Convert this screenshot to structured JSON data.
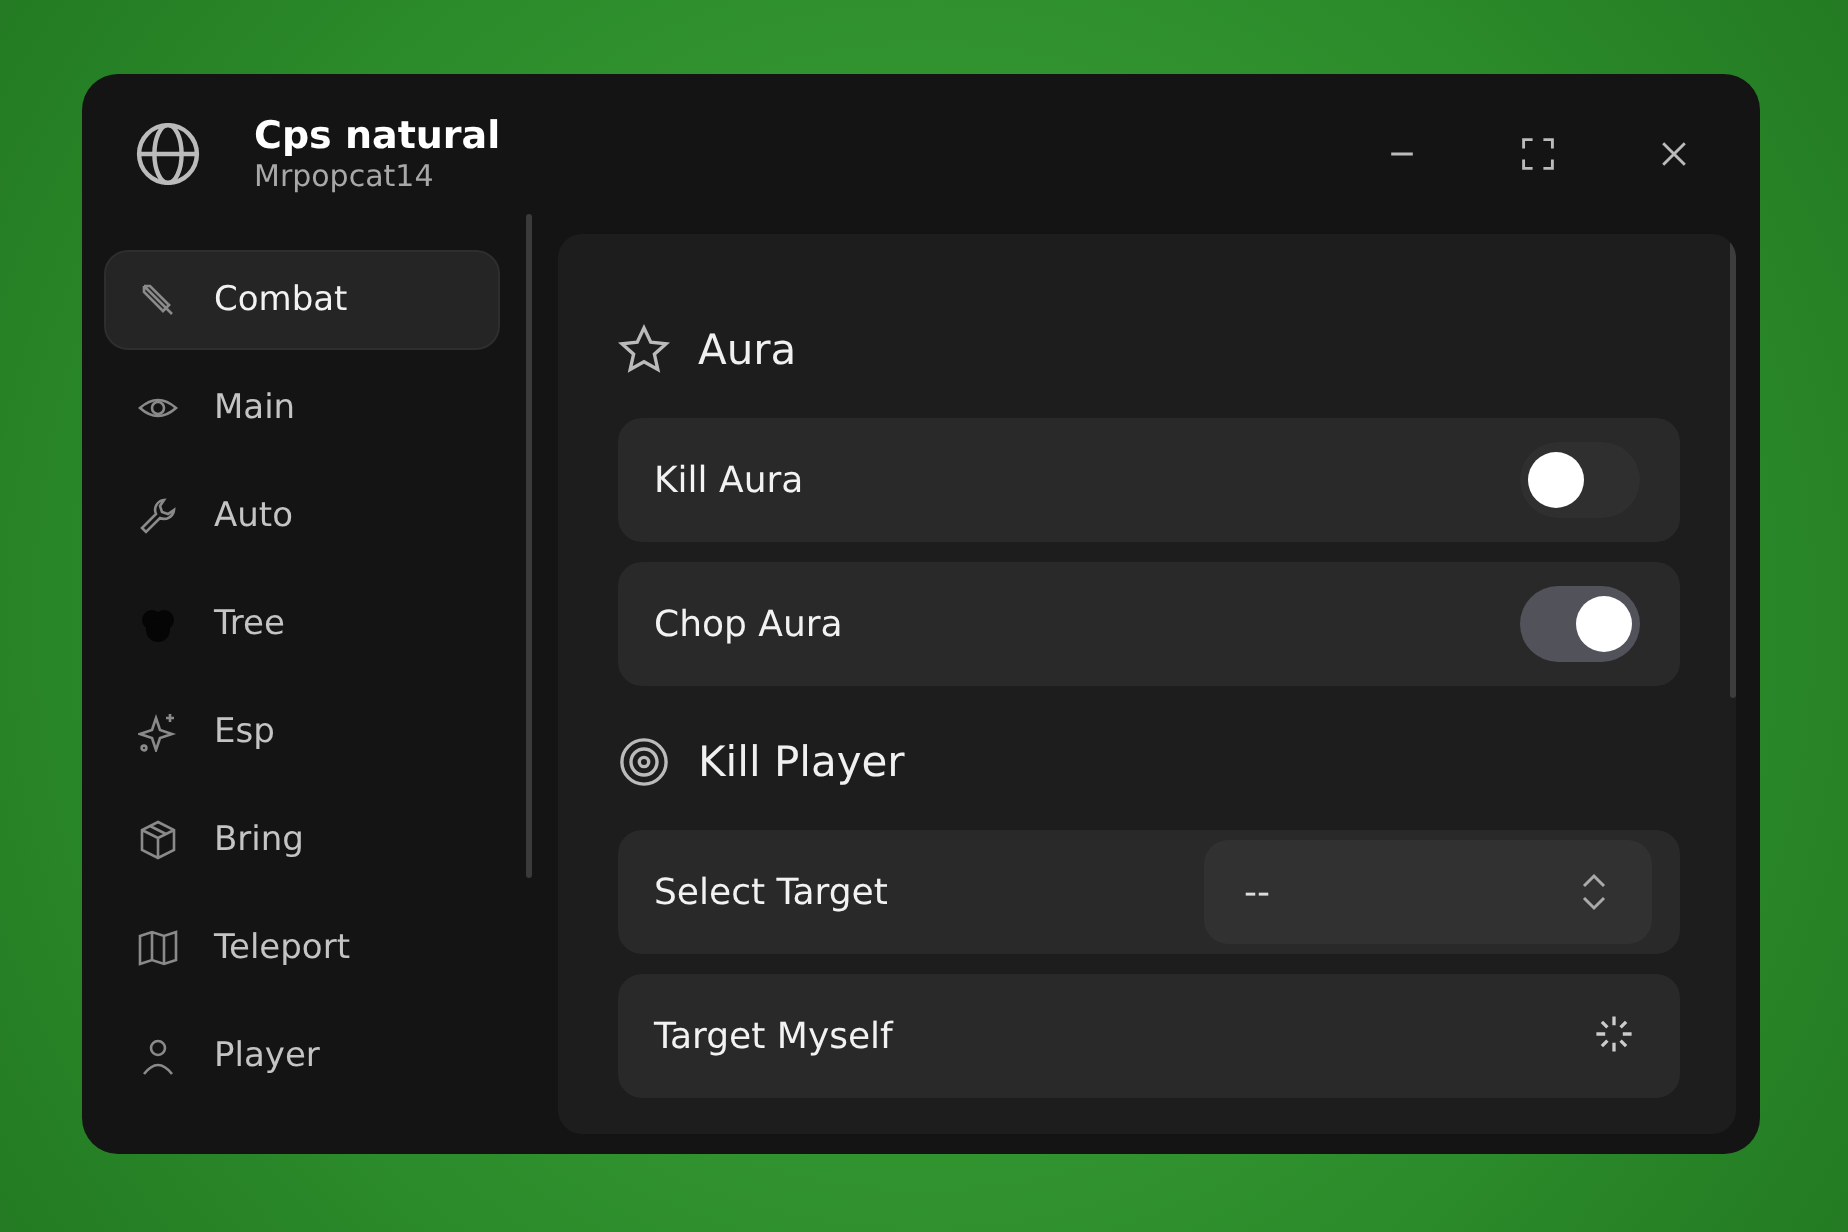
{
  "window": {
    "title": "Cps natural",
    "subtitle": "Mrpopcat14"
  },
  "sidebar": {
    "items": [
      {
        "label": "Combat",
        "selected": true
      },
      {
        "label": "Main",
        "selected": false
      },
      {
        "label": "Auto",
        "selected": false
      },
      {
        "label": "Tree",
        "selected": false
      },
      {
        "label": "Esp",
        "selected": false
      },
      {
        "label": "Bring",
        "selected": false
      },
      {
        "label": "Teleport",
        "selected": false
      },
      {
        "label": "Player",
        "selected": false
      }
    ]
  },
  "sections": [
    {
      "title": "Aura",
      "rows": [
        {
          "kind": "toggle",
          "label": "Kill Aura",
          "on": false
        },
        {
          "kind": "toggle",
          "label": "Chop Aura",
          "on": true
        }
      ]
    },
    {
      "title": "Kill Player",
      "rows": [
        {
          "kind": "dropdown",
          "label": "Select Target",
          "value": "--"
        },
        {
          "kind": "action",
          "label": "Target Myself"
        }
      ]
    }
  ]
}
